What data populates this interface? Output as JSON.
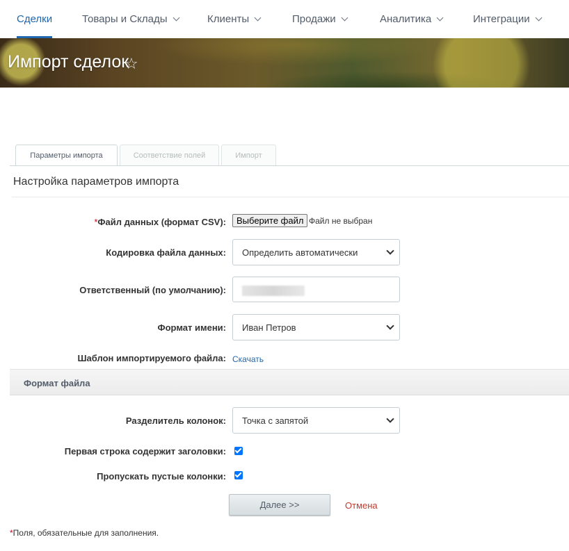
{
  "nav": {
    "items": [
      {
        "label": "Сделки",
        "active": true,
        "has_dropdown": false
      },
      {
        "label": "Товары и Склады",
        "active": false,
        "has_dropdown": true
      },
      {
        "label": "Клиенты",
        "active": false,
        "has_dropdown": true
      },
      {
        "label": "Продажи",
        "active": false,
        "has_dropdown": true
      },
      {
        "label": "Аналитика",
        "active": false,
        "has_dropdown": true
      },
      {
        "label": "Интеграции",
        "active": false,
        "has_dropdown": true
      }
    ],
    "accent_color": "#2067b0"
  },
  "header": {
    "title": "Импорт сделок",
    "star_icon": "star-outline-icon"
  },
  "tabs": [
    {
      "label": "Параметры импорта",
      "active": true
    },
    {
      "label": "Соответствие полей",
      "active": false
    },
    {
      "label": "Импорт",
      "active": false
    }
  ],
  "section": {
    "title": "Настройка параметров импорта"
  },
  "form": {
    "data_file": {
      "required_mark": "*",
      "label": "Файл данных (формат CSV):",
      "button_label": "Выберите файл",
      "status": "Файл не выбран"
    },
    "encoding": {
      "label": "Кодировка файла данных:",
      "value": "Определить автоматически"
    },
    "responsible": {
      "label": "Ответственный (по умолчанию):",
      "value": ""
    },
    "name_format": {
      "label": "Формат имени:",
      "value": "Иван Петров"
    },
    "template": {
      "label": "Шаблон импортируемого файла:",
      "link_label": "Скачать"
    }
  },
  "file_format": {
    "title": "Формат файла",
    "separator": {
      "label": "Разделитель колонок:",
      "value": "Точка с запятой"
    },
    "first_row_headers": {
      "label": "Первая строка содержит заголовки:",
      "checked": true
    },
    "skip_empty_columns": {
      "label": "Пропускать пустые колонки:",
      "checked": true
    }
  },
  "actions": {
    "next_label": "Далее >>",
    "cancel_label": "Отмена"
  },
  "footnote": {
    "mark": "*",
    "text": "Поля, обязательные для заполнения."
  }
}
